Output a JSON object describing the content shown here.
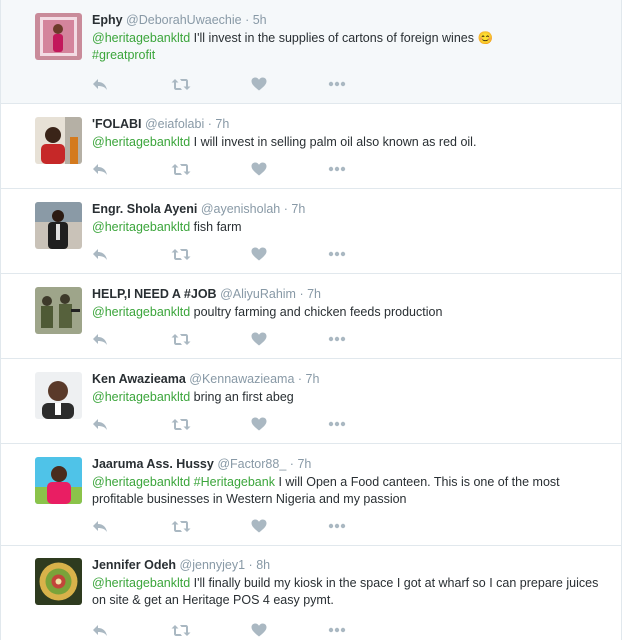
{
  "colors": {
    "link": "#3ba53b",
    "meta": "#8899a6",
    "icon": "#aab8c2",
    "name": "#292f33",
    "highlight_bg": "#f5f8fa"
  },
  "tweets": [
    {
      "name": "Ephy",
      "handle": "@DeborahUwaechie",
      "time": "5h",
      "mention": "@heritagebankltd",
      "hashtag": "",
      "text": "I'll invest in the supplies of cartons of foreign  wines",
      "emoji": "😊",
      "text2": "",
      "hashtag_after": "#greatprofit",
      "avatar_icon": "person-photo-icon"
    },
    {
      "name": "'FOLABI",
      "handle": "@eiafolabi",
      "time": "7h",
      "mention": "@heritagebankltd",
      "hashtag": "",
      "text": "I will invest in selling palm oil also known as red oil.",
      "avatar_icon": "person-photo-icon"
    },
    {
      "name": "Engr. Shola Ayeni",
      "handle": "@ayenisholah",
      "time": "7h",
      "mention": "@heritagebankltd",
      "hashtag": "",
      "text": "fish farm",
      "avatar_icon": "person-photo-icon"
    },
    {
      "name": "HELP,I NEED A #JOB",
      "handle": "@AliyuRahim",
      "time": "7h",
      "mention": "@heritagebankltd",
      "hashtag": "",
      "text": "poultry farming and chicken feeds production",
      "avatar_icon": "soldiers-photo-icon"
    },
    {
      "name": "Ken Awazieama",
      "handle": "@Kennawazieama",
      "time": "7h",
      "mention": "@heritagebankltd",
      "hashtag": "",
      "text": "bring an first abeg",
      "avatar_icon": "person-photo-icon"
    },
    {
      "name": "Jaaruma Ass. Hussy",
      "handle": "@Factor88_",
      "time": "7h",
      "mention": "@heritagebankltd",
      "hashtag": "#Heritagebank",
      "text": "I will Open a Food canteen. This is one of the most profitable businesses in Western Nigeria and my passion",
      "avatar_icon": "person-photo-icon"
    },
    {
      "name": "Jennifer Odeh",
      "handle": "@jennyjey1",
      "time": "8h",
      "mention": "@heritagebankltd",
      "hashtag": "",
      "text": "I'll finally build my kiosk in the space I got at wharf so I can prepare juices on site & get an Heritage POS 4 easy pymt.",
      "avatar_icon": "food-photo-icon"
    }
  ],
  "actions": [
    "reply-icon",
    "retweet-icon",
    "like-icon",
    "more-icon"
  ],
  "separator": "·"
}
